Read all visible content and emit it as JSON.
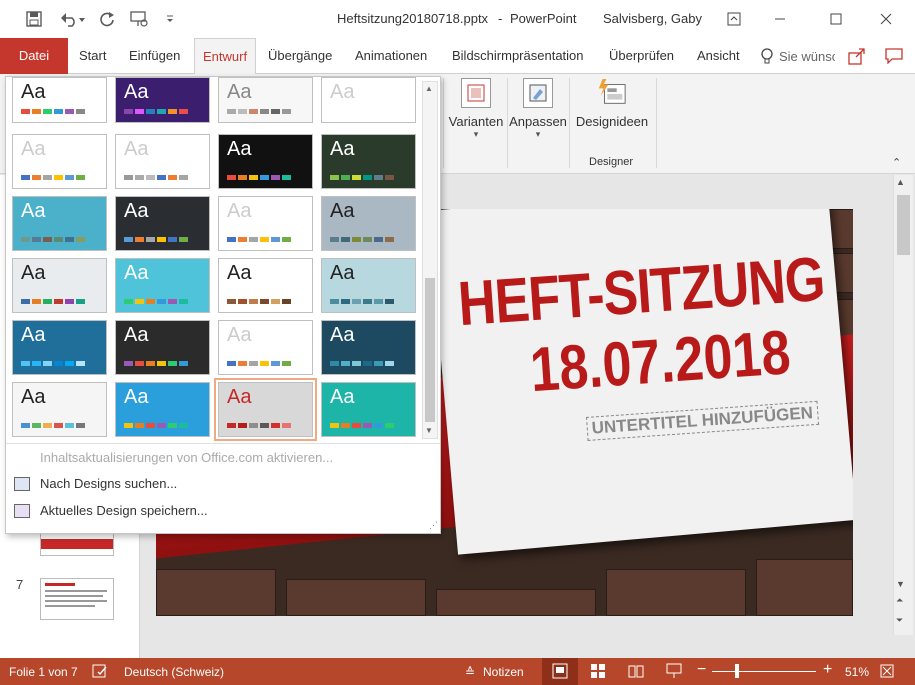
{
  "titlebar": {
    "document_title": "Heftsitzung20180718.pptx",
    "separator": "-",
    "app_name": "PowerPoint",
    "user_name": "Salvisberg, Gaby"
  },
  "tabs": [
    {
      "label": "Datei"
    },
    {
      "label": "Start"
    },
    {
      "label": "Einfügen"
    },
    {
      "label": "Entwurf"
    },
    {
      "label": "Übergänge"
    },
    {
      "label": "Animationen"
    },
    {
      "label": "Bildschirmpräsentation"
    },
    {
      "label": "Überprüfen"
    },
    {
      "label": "Ansicht"
    }
  ],
  "tell_me": {
    "placeholder": "Sie wünsc"
  },
  "ribbon": {
    "variants_label": "Varianten",
    "customize_label": "Anpassen",
    "design_ideas_label": "Designideen",
    "designer_group": "Designer"
  },
  "gallery": {
    "themes": [
      {
        "aa": "Aa",
        "bg": "#ffffff",
        "fg": "#222222",
        "colors": [
          "#e74c3c",
          "#e67e22",
          "#2ecc71",
          "#3498db",
          "#9b59b6",
          "#888888"
        ]
      },
      {
        "aa": "Aa",
        "bg": "#3c1e6e",
        "fg": "#ffffff",
        "colors": [
          "#8e44ad",
          "#e056fd",
          "#2980b9",
          "#22a6b3",
          "#f0932b",
          "#eb4d4b"
        ]
      },
      {
        "aa": "Aa",
        "bg": "#f7f7f7",
        "fg": "#888888",
        "colors": [
          "#aaaaaa",
          "#bbbbbb",
          "#cc8866",
          "#888888",
          "#666666",
          "#999999"
        ]
      },
      {
        "aa": "Aa",
        "bg": "#ffffff",
        "fg": "#cccccc",
        "colors": []
      },
      {
        "aa": "Aa",
        "bg": "#ffffff",
        "fg": "#cccccc",
        "colors": [
          "#4472c4",
          "#ed7d31",
          "#a5a5a5",
          "#ffc000",
          "#5b9bd5",
          "#70ad47"
        ]
      },
      {
        "aa": "Aa",
        "bg": "#ffffff",
        "fg": "#cccccc",
        "colors": [
          "#999999",
          "#aaaaaa",
          "#bbbbbb",
          "#4472c4",
          "#ed7d31",
          "#a5a5a5"
        ]
      },
      {
        "aa": "Aa",
        "bg": "#111111",
        "fg": "#ffffff",
        "colors": [
          "#e74c3c",
          "#e67e22",
          "#f1c40f",
          "#3498db",
          "#9b59b6",
          "#1abc9c"
        ]
      },
      {
        "aa": "Aa",
        "bg": "#2b3b2b",
        "fg": "#ffffff",
        "colors": [
          "#8bc34a",
          "#4caf50",
          "#cddc39",
          "#009688",
          "#607d8b",
          "#795548"
        ]
      },
      {
        "aa": "Aa",
        "bg": "#4bb0c9",
        "fg": "#ffffff",
        "colors": [
          "#6d9a8c",
          "#557a95",
          "#7c5c4a",
          "#5b8a72",
          "#3e7090",
          "#8c9a5c"
        ]
      },
      {
        "aa": "Aa",
        "bg": "#2a2e33",
        "fg": "#ffffff",
        "colors": [
          "#5b9bd5",
          "#ed7d31",
          "#a5a5a5",
          "#ffc000",
          "#4472c4",
          "#70ad47"
        ]
      },
      {
        "aa": "Aa",
        "bg": "#ffffff",
        "fg": "#cccccc",
        "colors": [
          "#4472c4",
          "#ed7d31",
          "#a5a5a5",
          "#ffc000",
          "#5b9bd5",
          "#70ad47"
        ]
      },
      {
        "aa": "Aa",
        "bg": "#a9b8c2",
        "fg": "#222222",
        "colors": [
          "#5a7d8c",
          "#3e6a7a",
          "#7c8b3a",
          "#6e8a5c",
          "#4a6a8c",
          "#8c6a4a"
        ]
      },
      {
        "aa": "Aa",
        "bg": "#e8ecef",
        "fg": "#222222",
        "colors": [
          "#3a6ea5",
          "#e67e22",
          "#27ae60",
          "#c0392b",
          "#8e44ad",
          "#16a085"
        ]
      },
      {
        "aa": "Aa",
        "bg": "#4fc3d9",
        "fg": "#ffffff",
        "colors": [
          "#2ecc71",
          "#f1c40f",
          "#e67e22",
          "#3498db",
          "#9b59b6",
          "#1abc9c"
        ]
      },
      {
        "aa": "Aa",
        "bg": "#ffffff",
        "fg": "#222222",
        "colors": [
          "#8c5a3a",
          "#a0522d",
          "#c27c4a",
          "#7a4a2a",
          "#d2a060",
          "#6b4226"
        ]
      },
      {
        "aa": "Aa",
        "bg": "#b8d8e0",
        "fg": "#222222",
        "colors": [
          "#4a8ca0",
          "#2e6a80",
          "#6aa0b0",
          "#3a7a8c",
          "#5a9aa8",
          "#2a5a6c"
        ]
      },
      {
        "aa": "Aa",
        "bg": "#1f6f9a",
        "fg": "#ffffff",
        "colors": [
          "#4fc3f7",
          "#29b6f6",
          "#81d4fa",
          "#0288d1",
          "#03a9f4",
          "#b3e5fc"
        ]
      },
      {
        "aa": "Aa",
        "bg": "#2b2b2b",
        "fg": "#ffffff",
        "colors": [
          "#9b59b6",
          "#e74c3c",
          "#e67e22",
          "#f1c40f",
          "#2ecc71",
          "#3498db"
        ]
      },
      {
        "aa": "Aa",
        "bg": "#ffffff",
        "fg": "#cccccc",
        "colors": [
          "#4472c4",
          "#ed7d31",
          "#a5a5a5",
          "#ffc000",
          "#5b9bd5",
          "#70ad47"
        ]
      },
      {
        "aa": "Aa",
        "bg": "#1d4a60",
        "fg": "#ffffff",
        "colors": [
          "#2e8ba8",
          "#4fb0c8",
          "#7cc8d8",
          "#1a6a88",
          "#3a9ab8",
          "#a0d8e8"
        ]
      },
      {
        "aa": "Aa",
        "bg": "#f5f5f5",
        "fg": "#222222",
        "colors": [
          "#4a90d9",
          "#5cb85c",
          "#f0ad4e",
          "#d9534f",
          "#5bc0de",
          "#777777"
        ]
      },
      {
        "aa": "Aa",
        "bg": "#2a9fdb",
        "fg": "#ffffff",
        "colors": [
          "#f1c40f",
          "#e67e22",
          "#e74c3c",
          "#9b59b6",
          "#2ecc71",
          "#1abc9c"
        ]
      },
      {
        "aa": "Aa",
        "bg": "#d8d8d8",
        "fg": "#c62828",
        "colors": [
          "#c62828",
          "#b71c1c",
          "#8e8e8e",
          "#5a5a5a",
          "#d32f2f",
          "#e57373"
        ]
      },
      {
        "aa": "Aa",
        "bg": "#1cb5a8",
        "fg": "#ffffff",
        "colors": [
          "#f1c40f",
          "#e67e22",
          "#e74c3c",
          "#9b59b6",
          "#3498db",
          "#2ecc71"
        ]
      }
    ],
    "menu_update": "Inhaltsaktualisierungen von Office.com aktivieren...",
    "menu_search": "Nach Designs suchen...",
    "menu_save": "Aktuelles Design speichern..."
  },
  "slide": {
    "title_line1": "HEFT-SITZUNG",
    "title_line2": "18.07.2018",
    "subtitle": "UNTERTITEL HINZUFÜGEN"
  },
  "thumbnails": {
    "slide_7_number": "7"
  },
  "statusbar": {
    "slide_info": "Folie 1 von 7",
    "language": "Deutsch (Schweiz)",
    "notes_label": "Notizen",
    "zoom_percent": "51%"
  },
  "colors": {
    "accent": "#c5372d",
    "statusbar": "#b7472a"
  }
}
